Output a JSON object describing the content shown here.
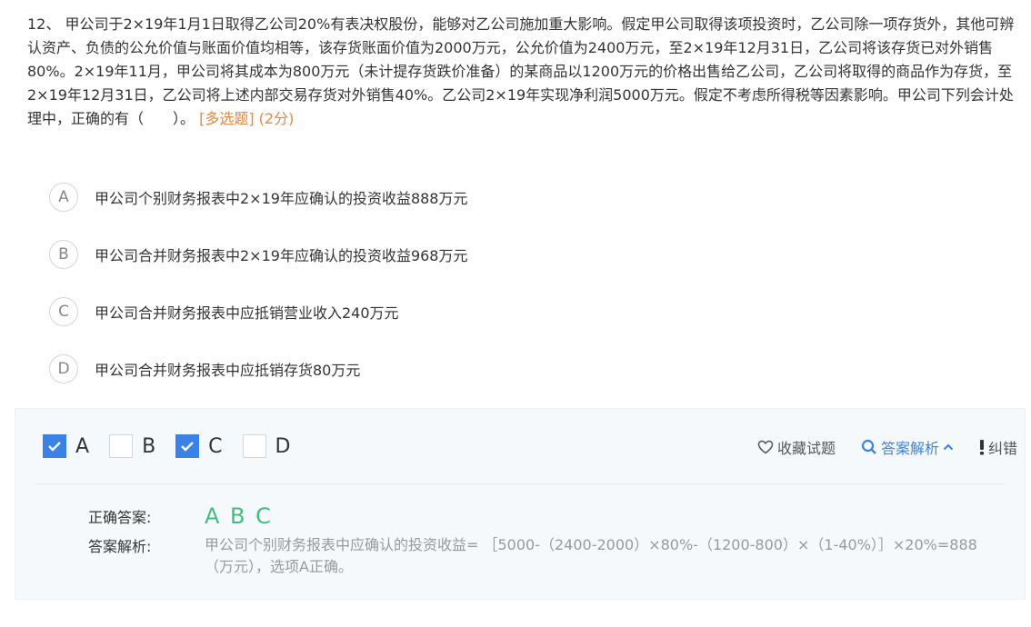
{
  "question": {
    "text": "12、 甲公司于2×19年1月1日取得乙公司20%有表决权股份，能够对乙公司施加重大影响。假定甲公司取得该项投资时，乙公司除一项存货外，其他可辨认资产、负债的公允价值与账面价值均相等，该存货账面价值为2000万元，公允价值为2400万元，至2×19年12月31日，乙公司将该存货已对外销售80%。2×19年11月，甲公司将其成本为800万元（未计提存货跌价准备）的某商品以1200万元的价格出售给乙公司，乙公司将取得的商品作为存货，至2×19年12月31日，乙公司将上述内部交易存货对外销售40%。乙公司2×19年实现净利润5000万元。假定不考虑所得税等因素影响。甲公司下列会计处理中，正确的有（　　）。",
    "tag": "[多选题] (2分)"
  },
  "options": [
    {
      "letter": "A",
      "text": "甲公司个别财务报表中2×19年应确认的投资收益888万元"
    },
    {
      "letter": "B",
      "text": "甲公司合并财务报表中2×19年应确认的投资收益968万元"
    },
    {
      "letter": "C",
      "text": "甲公司合并财务报表中应抵销营业收入240万元"
    },
    {
      "letter": "D",
      "text": "甲公司合并财务报表中应抵销存货80万元"
    }
  ],
  "answer_panel": {
    "choices": [
      {
        "label": "A",
        "checked": true
      },
      {
        "label": "B",
        "checked": false
      },
      {
        "label": "C",
        "checked": true
      },
      {
        "label": "D",
        "checked": false
      }
    ],
    "actions": {
      "favorite": "收藏试题",
      "analysis": "答案解析",
      "report": "纠错"
    },
    "correct_label": "正确答案:",
    "correct_value": "A B C",
    "explain_label": "答案解析:",
    "explain_text": "甲公司个别财务报表中应确认的投资收益= ［5000-（2400-2000）×80%-（1200-800）×（1-40%）］×20%=888（万元），选项A正确。"
  },
  "colors": {
    "accent": "#3b82e6",
    "tag": "#e8863d",
    "correct": "#3fc07a"
  }
}
